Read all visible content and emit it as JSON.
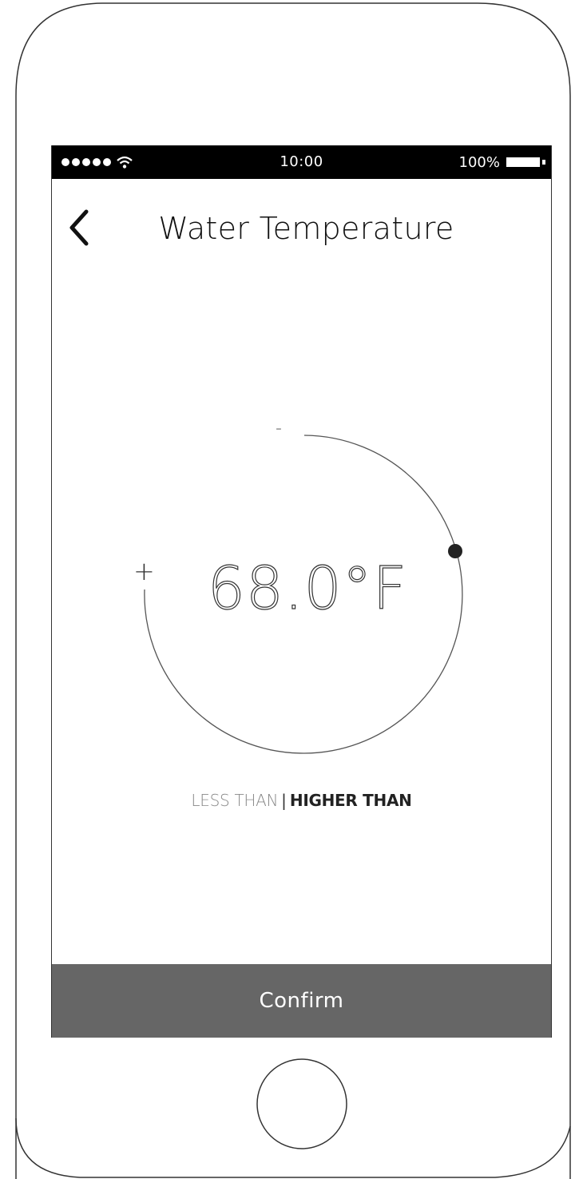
{
  "status_bar": {
    "time": "10:00",
    "battery": "100%",
    "signal_icon": "signal-dots-icon",
    "wifi_icon": "wifi-icon",
    "battery_icon": "battery-icon"
  },
  "header": {
    "title": "Water Temperature",
    "back_icon": "chevron-left-icon"
  },
  "dial": {
    "value_text": "68.0°F",
    "minus_label": "-",
    "plus_label": "+",
    "knob_icon": "dial-knob-icon"
  },
  "mode_toggle": {
    "less_label": "LESS THAN",
    "separator": "|",
    "higher_label": "HIGHER THAN",
    "selected": "HIGHER THAN"
  },
  "footer": {
    "confirm_label": "Confirm"
  },
  "colors": {
    "status_bar_bg": "#000000",
    "confirm_bg": "#666666",
    "knob": "#222222"
  }
}
